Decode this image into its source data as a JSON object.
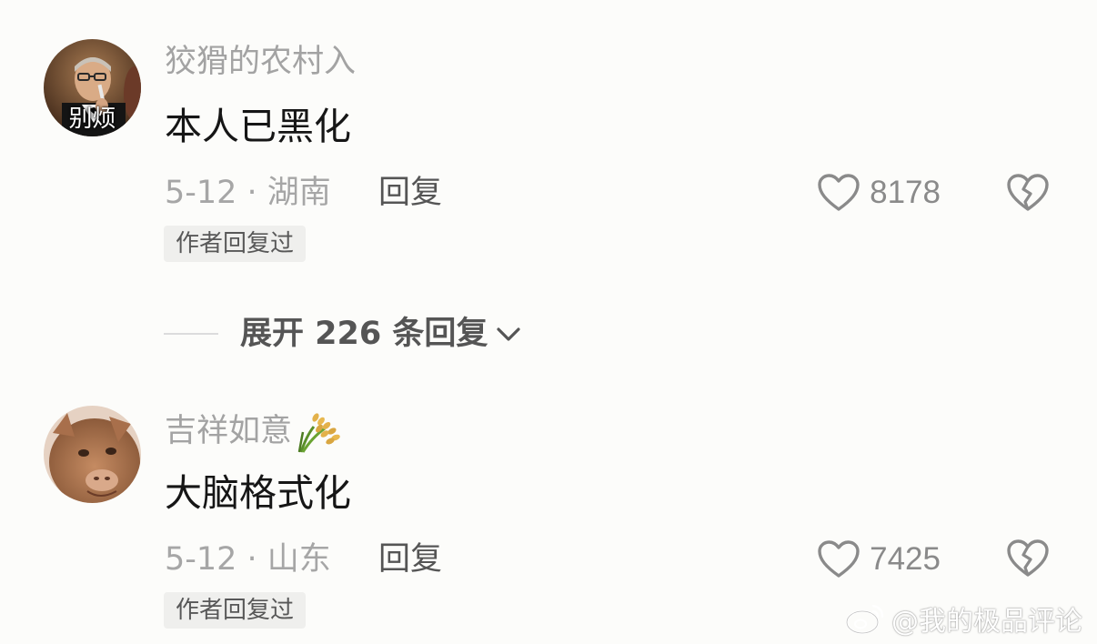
{
  "comments": [
    {
      "username": "狡猾的农村入",
      "avatar_caption": "别烦",
      "text": "本人已黑化",
      "date_location": "5-12 · 湖南",
      "reply_label": "回复",
      "likes": "8178",
      "author_badge": "作者回复过"
    },
    {
      "username": "吉祥如意",
      "username_emoji": "rice-ear-emoji",
      "text": "大脑格式化",
      "date_location": "5-12 · 山东",
      "reply_label": "回复",
      "likes": "7425",
      "author_badge": "作者回复过"
    }
  ],
  "expand": {
    "label": "展开 226 条回复"
  },
  "watermark": {
    "text": "@我的极品评论"
  },
  "icons": {
    "like": "heart-outline-icon",
    "dislike": "broken-heart-icon",
    "expand": "chevron-down-icon",
    "watermark": "weibo-logo-icon"
  },
  "colors": {
    "background": "#fcfcfa",
    "username": "#a3a3a3",
    "text": "#161616",
    "meta": "#a6a6a6",
    "badge_bg": "#efefed"
  }
}
